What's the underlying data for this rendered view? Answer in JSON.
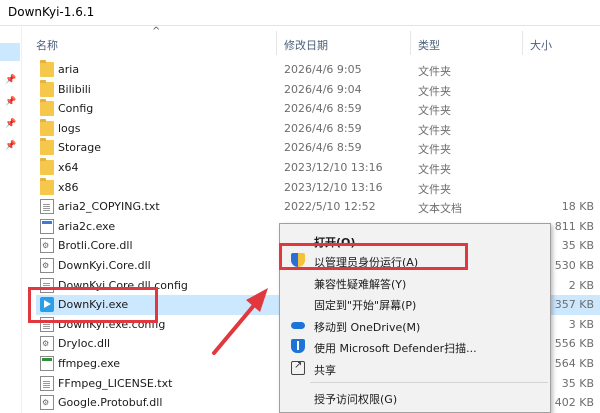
{
  "window": {
    "title": "DownKyi-1.6.1"
  },
  "columns": {
    "name": "名称",
    "date": "修改日期",
    "type": "类型",
    "size": "大小"
  },
  "files": [
    {
      "name": "aria",
      "date": "2026/4/6 9:05",
      "type": "文件夹",
      "size": "",
      "icon": "folder-icon"
    },
    {
      "name": "Bilibili",
      "date": "2026/4/6 9:04",
      "type": "文件夹",
      "size": "",
      "icon": "folder-icon"
    },
    {
      "name": "Config",
      "date": "2026/4/6 8:59",
      "type": "文件夹",
      "size": "",
      "icon": "folder-icon"
    },
    {
      "name": "logs",
      "date": "2026/4/6 8:59",
      "type": "文件夹",
      "size": "",
      "icon": "folder-icon"
    },
    {
      "name": "Storage",
      "date": "2026/4/6 8:59",
      "type": "文件夹",
      "size": "",
      "icon": "folder-icon"
    },
    {
      "name": "x64",
      "date": "2023/12/10 13:16",
      "type": "文件夹",
      "size": "",
      "icon": "folder-icon"
    },
    {
      "name": "x86",
      "date": "2023/12/10 13:16",
      "type": "文件夹",
      "size": "",
      "icon": "folder-icon"
    },
    {
      "name": "aria2_COPYING.txt",
      "date": "2022/5/10 12:52",
      "type": "文本文档",
      "size": "18 KB",
      "icon": "text-file-icon"
    },
    {
      "name": "aria2c.exe",
      "date": "",
      "type": "",
      "size": "811 KB",
      "icon": "exe-file-icon"
    },
    {
      "name": "Brotli.Core.dll",
      "date": "",
      "type": "",
      "size": "35 KB",
      "icon": "dll-file-icon"
    },
    {
      "name": "DownKyi.Core.dll",
      "date": "",
      "type": "",
      "size": "530 KB",
      "icon": "dll-file-icon"
    },
    {
      "name": "DownKyi.Core.dll.config",
      "date": "",
      "type": "",
      "size": "2 KB",
      "icon": "config-file-icon"
    },
    {
      "name": "DownKyi.exe",
      "date": "",
      "type": "",
      "size": "357 KB",
      "icon": "downkyi-app-icon"
    },
    {
      "name": "DownKyi.exe.config",
      "date": "",
      "type": "",
      "size": "3 KB",
      "icon": "config-file-icon"
    },
    {
      "name": "DryIoc.dll",
      "date": "",
      "type": "",
      "size": "556 KB",
      "icon": "dll-file-icon"
    },
    {
      "name": "ffmpeg.exe",
      "date": "",
      "type": "",
      "size": "564 KB",
      "icon": "ffmpeg-exe-icon"
    },
    {
      "name": "FFmpeg_LICENSE.txt",
      "date": "",
      "type": "",
      "size": "35 KB",
      "icon": "text-file-icon"
    },
    {
      "name": "Google.Protobuf.dll",
      "date": "",
      "type": "",
      "size": "402 KB",
      "icon": "dll-file-icon"
    }
  ],
  "context_menu": {
    "open": "打开(O)",
    "run_as_admin": "以管理员身份运行(A)",
    "troubleshoot": "兼容性疑难解答(Y)",
    "pin_start": "固定到\"开始\"屏幕(P)",
    "onedrive": "移动到 OneDrive(M)",
    "defender": "使用 Microsoft Defender扫描...",
    "share": "共享",
    "grant_access": "授予访问权限(G)"
  },
  "colors": {
    "highlight": "#e0383e",
    "selection": "#cce8ff"
  }
}
